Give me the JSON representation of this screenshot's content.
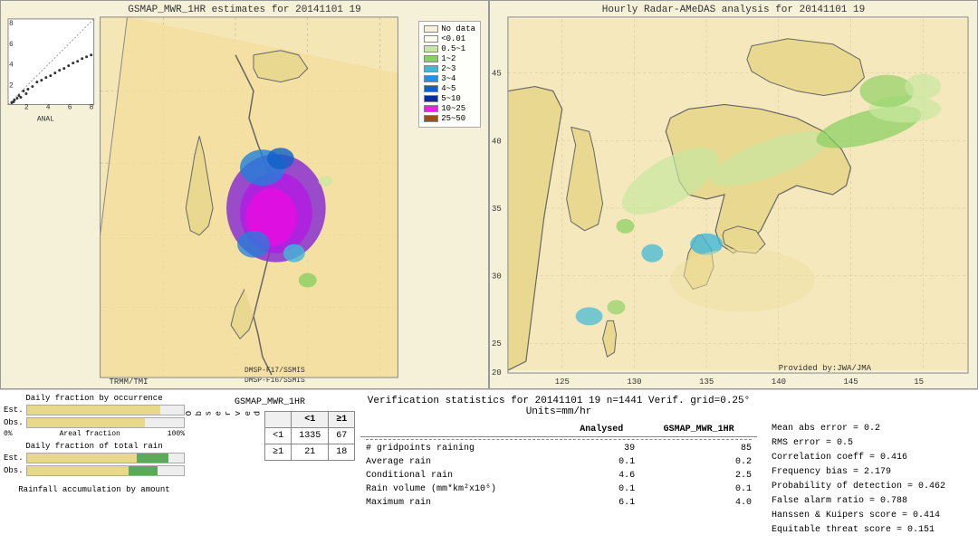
{
  "left_map": {
    "title": "GSMAP_MWR_1HR estimates for 20141101 19",
    "scatter_label": "ANAL",
    "dmsp_labels": [
      "TRMM/TMI",
      "DMSP-F17/SSMIS",
      "DMSP-F16/SSMIS"
    ],
    "axis_labels": {
      "y8": "8",
      "y6": "6",
      "y4": "4",
      "y2": "2",
      "x2": "2",
      "x4": "4",
      "x6": "6",
      "x8": "8"
    }
  },
  "right_map": {
    "title": "Hourly Radar-AMeDAS analysis for 20141101 19",
    "lat_labels": [
      "45",
      "40",
      "35",
      "30",
      "25",
      "20"
    ],
    "lon_labels": [
      "125",
      "130",
      "135",
      "140",
      "145",
      "15"
    ],
    "provided_label": "Provided by:JWA/JMA"
  },
  "legend": {
    "title": "",
    "items": [
      {
        "label": "No data",
        "color": "#f5f0d8"
      },
      {
        "label": "<0.01",
        "color": "#fdfcf0"
      },
      {
        "label": "0.5~1",
        "color": "#c8e8a0"
      },
      {
        "label": "1~2",
        "color": "#88d060"
      },
      {
        "label": "2~3",
        "color": "#40b8d8"
      },
      {
        "label": "3~4",
        "color": "#2090e8"
      },
      {
        "label": "4~5",
        "color": "#1060c8"
      },
      {
        "label": "5~10",
        "color": "#0030a0"
      },
      {
        "label": "10~25",
        "color": "#e820e8"
      },
      {
        "label": "25~50",
        "color": "#a05010"
      }
    ]
  },
  "bar_charts": {
    "occurrence_title": "Daily fraction by occurrence",
    "rain_title": "Daily fraction of total rain",
    "accumulation_title": "Rainfall accumulation by amount",
    "est_label": "Est.",
    "obs_label": "Obs.",
    "axis_0": "0%",
    "axis_100": "Areal fraction",
    "axis_100_label": "100%"
  },
  "contingency": {
    "title": "GSMAP_MWR_1HR",
    "col_headers": [
      "",
      "<1",
      "≥1"
    ],
    "row_header_label": "O\nb\ns\ne\nr\nv\ne\nd",
    "row_lt1_label": "<1",
    "row_ge1_label": "≥1",
    "cell_lt1_lt1": "1335",
    "cell_lt1_ge1": "67",
    "cell_ge1_lt1": "21",
    "cell_ge1_ge1": "18"
  },
  "verification": {
    "title": "Verification statistics for 20141101 19  n=1441  Verif. grid=0.25°  Units=mm/hr",
    "headers": [
      "",
      "Analysed",
      "GSMAP_MWR_1HR"
    ],
    "rows": [
      {
        "label": "# gridpoints raining",
        "analysed": "39",
        "gsmap": "85"
      },
      {
        "label": "Average rain",
        "analysed": "0.1",
        "gsmap": "0.2"
      },
      {
        "label": "Conditional rain",
        "analysed": "4.6",
        "gsmap": "2.5"
      },
      {
        "label": "Rain volume (mm*km²x10⁶)",
        "analysed": "0.1",
        "gsmap": "0.1"
      },
      {
        "label": "Maximum rain",
        "analysed": "6.1",
        "gsmap": "4.0"
      }
    ]
  },
  "right_stats": {
    "mean_abs_error": "Mean abs error = 0.2",
    "rms_error": "RMS error = 0.5",
    "correlation": "Correlation coeff = 0.416",
    "freq_bias": "Frequency bias = 2.179",
    "prob_detection": "Probability of detection = 0.462",
    "false_alarm": "False alarm ratio = 0.788",
    "hanssen": "Hanssen & Kuipers score = 0.414",
    "equitable": "Equitable threat score = 0.151"
  }
}
